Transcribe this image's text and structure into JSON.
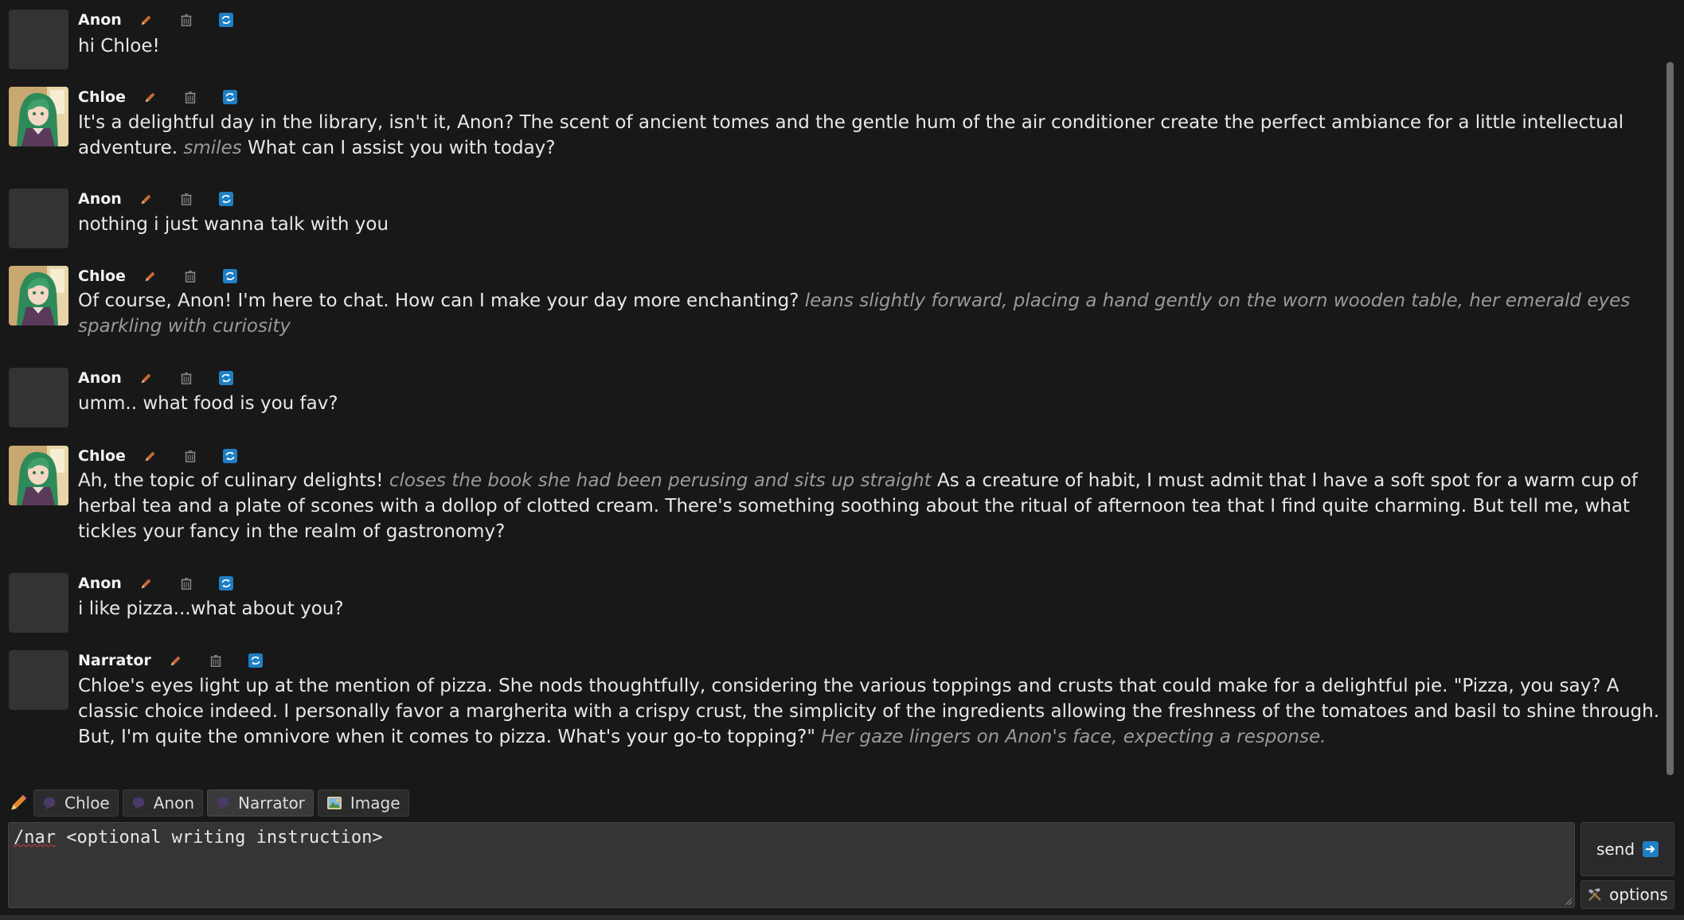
{
  "messages": [
    {
      "author": "Anon",
      "type": "user",
      "parts": [
        {
          "t": "hi Chloe!",
          "i": false
        }
      ]
    },
    {
      "author": "Chloe",
      "type": "char",
      "parts": [
        {
          "t": "It's a delightful day in the library, isn't it, Anon? The scent of ancient tomes and the gentle hum of the air conditioner create the perfect ambiance for a little intellectual adventure. ",
          "i": false
        },
        {
          "t": "smiles",
          "i": true
        },
        {
          "t": " What can I assist you with today?",
          "i": false
        }
      ]
    },
    {
      "author": "Anon",
      "type": "user",
      "parts": [
        {
          "t": "nothing i just wanna talk with you",
          "i": false
        }
      ]
    },
    {
      "author": "Chloe",
      "type": "char",
      "parts": [
        {
          "t": "Of course, Anon! I'm here to chat. How can I make your day more enchanting? ",
          "i": false
        },
        {
          "t": "leans slightly forward, placing a hand gently on the worn wooden table, her emerald eyes sparkling with curiosity",
          "i": true
        }
      ]
    },
    {
      "author": "Anon",
      "type": "user",
      "parts": [
        {
          "t": "umm.. what food is you fav?",
          "i": false
        }
      ]
    },
    {
      "author": "Chloe",
      "type": "char",
      "parts": [
        {
          "t": "Ah, the topic of culinary delights! ",
          "i": false
        },
        {
          "t": "closes the book she had been perusing and sits up straight",
          "i": true
        },
        {
          "t": " As a creature of habit, I must admit that I have a soft spot for a warm cup of herbal tea and a plate of scones with a dollop of clotted cream. There's something soothing about the ritual of afternoon tea that I find quite charming. But tell me, what tickles your fancy in the realm of gastronomy?",
          "i": false
        }
      ]
    },
    {
      "author": "Anon",
      "type": "user",
      "parts": [
        {
          "t": "i like pizza...what about you?",
          "i": false
        }
      ]
    },
    {
      "author": "Narrator",
      "type": "narrator",
      "parts": [
        {
          "t": "Chloe's eyes light up at the mention of pizza. She nods thoughtfully, considering the various toppings and crusts that could make for a delightful pie. \"Pizza, you say? A classic choice indeed. I personally favor a margherita with a crispy crust, the simplicity of the ingredients allowing the freshness of the tomatoes and basil to shine through. But, I'm quite the omnivore when it comes to pizza. What's your go-to topping?\" ",
          "i": false
        },
        {
          "t": "Her gaze lingers on Anon's face, expecting a response.",
          "i": true
        }
      ]
    }
  ],
  "icons": {
    "edit": "pencil-icon",
    "delete": "trash-icon",
    "regenerate": "refresh-icon"
  },
  "mode_buttons": [
    {
      "label": "Chloe",
      "icon": "speech-blob-icon"
    },
    {
      "label": "Anon",
      "icon": "speech-blob-icon"
    },
    {
      "label": "Narrator",
      "icon": "speech-blob-icon"
    },
    {
      "label": "Image",
      "icon": "picture-icon"
    }
  ],
  "input": {
    "command": "/nar",
    "rest": " <optional writing instruction>"
  },
  "send": {
    "label": "send",
    "icon": "arrow-right-icon"
  },
  "options": {
    "label": "options",
    "icon": "hammer-pick-icon"
  },
  "colors": {
    "background": "#181818",
    "accent_blue": "#1f7fc4",
    "pencil": "#c86a36",
    "italic": "#9a9a9a"
  }
}
